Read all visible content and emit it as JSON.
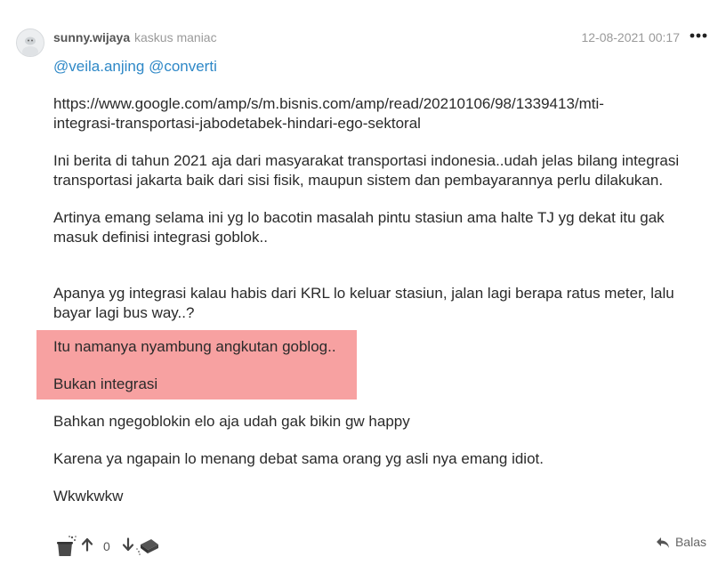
{
  "post": {
    "username": "sunny.wijaya",
    "rank": "kaskus maniac",
    "timestamp": "12-08-2021 00:17",
    "mention1": "@veila.anjing",
    "mention2": "@converti",
    "link_line1": "https://www.google.com/amp/s/m.bisnis.com/amp/read/20210106/98/1339413/mti-",
    "link_line2": "integrasi-transportasi-jabodetabek-hindari-ego-sektoral",
    "para1_line1": "Ini berita di tahun 2021 aja dari masyarakat transportasi indonesia..udah jelas bilang integrasi",
    "para1_line2": "transportasi jakarta baik dari sisi fisik, maupun sistem dan pembayarannya perlu dilakukan.",
    "para2_line1": "Artinya emang selama ini yg lo bacotin masalah pintu stasiun ama halte TJ yg dekat itu gak",
    "para2_line2": "masuk definisi integrasi goblok..",
    "para3_line1": "Apanya yg integrasi kalau habis dari KRL lo keluar stasiun, jalan lagi berapa ratus meter, lalu",
    "para3_line2": "bayar lagi bus way..?",
    "highlight_line1": "Itu namanya nyambung angkutan goblog..",
    "highlight_line2": "Bukan integrasi",
    "para4": "Bahkan ngegoblokin elo aja udah gak bikin gw happy",
    "para5": "Karena ya ngapain lo menang debat sama orang yg asli nya emang idiot.",
    "para6": "Wkwkwkw"
  },
  "actions": {
    "vote_count": "0",
    "reply_label": "Balas"
  },
  "icons": {
    "avatar": "avatar-icon",
    "more": "more-options-icon",
    "cendol": "cendol-icon",
    "upvote": "arrow-up-icon",
    "downvote": "arrow-down-icon",
    "bata": "bata-brick-icon",
    "reply": "reply-icon"
  },
  "colors": {
    "link": "#2e88c7",
    "highlight": "#f7a1a1",
    "muted": "#9a9a9a"
  }
}
